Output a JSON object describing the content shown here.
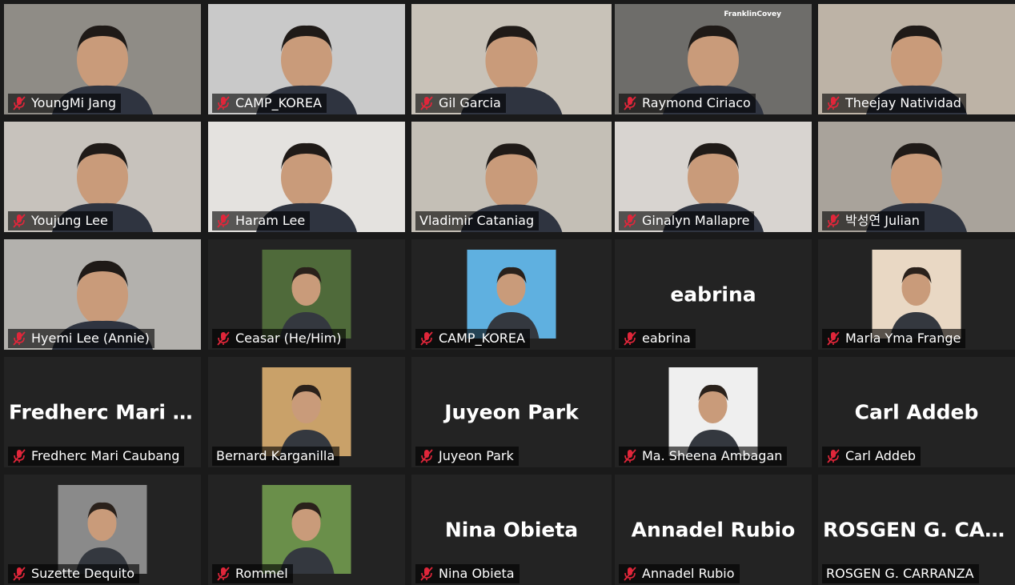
{
  "participants": [
    {
      "name": "YoungMi Jang",
      "type": "video",
      "muted": true,
      "bg": "#8f8c86"
    },
    {
      "name": "CAMP_KOREA",
      "type": "video",
      "muted": true,
      "bg": "#c9c9c9"
    },
    {
      "name": "Gil Garcia",
      "type": "video",
      "muted": true,
      "bg": "#c8c2b8"
    },
    {
      "name": "Raymond Ciriaco",
      "type": "video",
      "muted": true,
      "bg": "#6e6d6a",
      "brand": "FranklinCovey"
    },
    {
      "name": "Theejay Natividad",
      "type": "video",
      "muted": true,
      "bg": "#bdb3a6"
    },
    {
      "name": "Youjung Lee",
      "type": "video",
      "muted": true,
      "bg": "#c7c2bc"
    },
    {
      "name": "Haram Lee",
      "type": "video",
      "muted": true,
      "bg": "#e4e2df"
    },
    {
      "name": "Vladimir Cataniag",
      "type": "video",
      "muted": false,
      "active": true,
      "bg": "#c4bfb6"
    },
    {
      "name": "Ginalyn Mallapre",
      "type": "video",
      "muted": true,
      "bg": "#d8d4d0"
    },
    {
      "name": "박성연 Julian",
      "type": "video",
      "muted": true,
      "bg": "#a9a39b"
    },
    {
      "name": "Hyemi Lee (Annie)",
      "type": "video",
      "muted": true,
      "bg": "#b3b1ad"
    },
    {
      "name": "Ceasar (He/Him)",
      "type": "photo",
      "muted": true,
      "photo": "#4f6a3a"
    },
    {
      "name": "CAMP_KOREA",
      "type": "photo",
      "muted": true,
      "photo": "#5fb0e0"
    },
    {
      "name": "eabrina",
      "type": "text",
      "muted": true,
      "display": "eabrina"
    },
    {
      "name": "Marla Yma Frange",
      "type": "photo",
      "muted": true,
      "photo": "#e9d8c4"
    },
    {
      "name": "Fredherc Mari Caubang",
      "type": "text",
      "muted": true,
      "display": "Fredherc Mari C..."
    },
    {
      "name": "Bernard Karganilla",
      "type": "photo",
      "muted": false,
      "photo": "#c9a169"
    },
    {
      "name": "Juyeon Park",
      "type": "text",
      "muted": true,
      "display": "Juyeon Park"
    },
    {
      "name": "Ma. Sheena Ambagan",
      "type": "photo",
      "muted": true,
      "photo": "#efefef"
    },
    {
      "name": "Carl Addeb",
      "type": "text",
      "muted": true,
      "display": "Carl Addeb"
    },
    {
      "name": "Suzette Dequito",
      "type": "photo",
      "muted": true,
      "photo": "#8a8a8a"
    },
    {
      "name": "Rommel",
      "type": "photo",
      "muted": true,
      "photo": "#6a8f4a"
    },
    {
      "name": "Nina Obieta",
      "type": "text",
      "muted": true,
      "display": "Nina Obieta"
    },
    {
      "name": "Annadel Rubio",
      "type": "text",
      "muted": true,
      "display": "Annadel Rubio"
    },
    {
      "name": "ROSGEN G. CARRANZA",
      "type": "text",
      "muted": false,
      "display": "ROSGEN G. CAR..."
    }
  ],
  "colors": {
    "active_border": "#d6e274",
    "muted_icon": "#e0263a",
    "tile_bg": "#232323"
  },
  "icons": {
    "muted": "mic-muted-icon"
  }
}
